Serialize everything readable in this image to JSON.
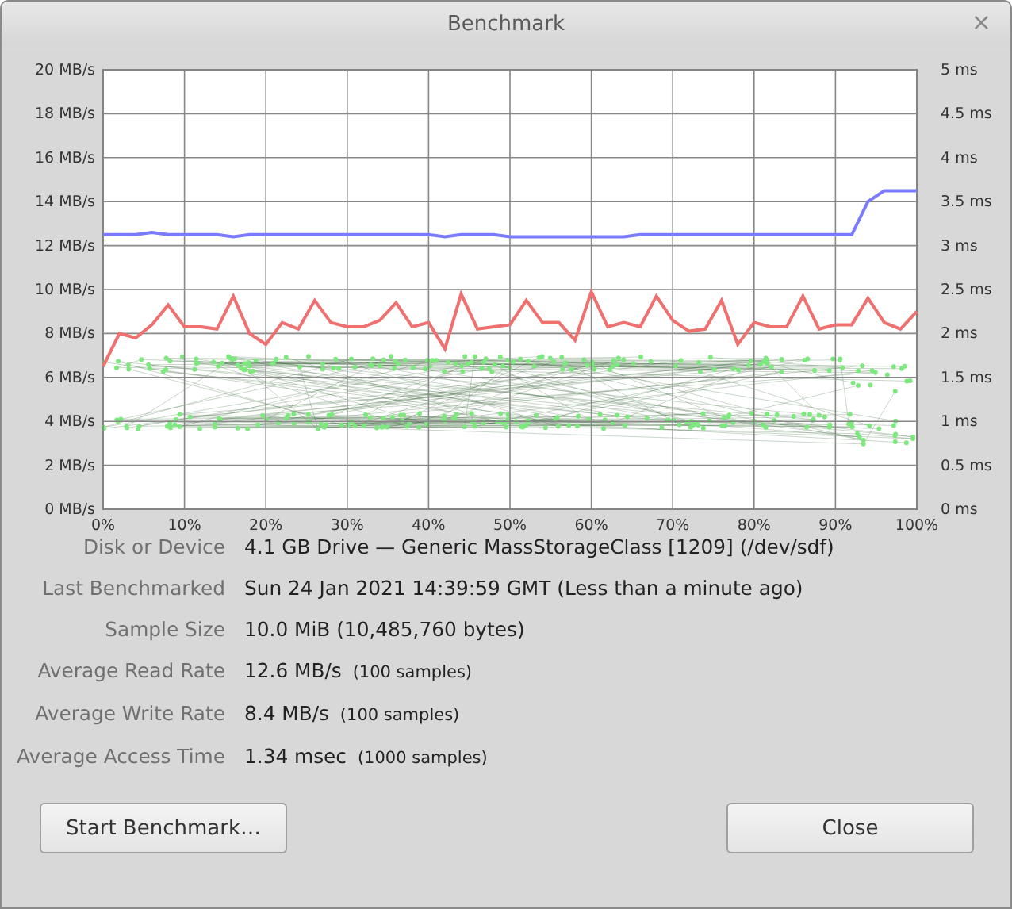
{
  "window": {
    "title": "Benchmark",
    "close_glyph": "×"
  },
  "chart": {
    "chart_data": {
      "type": "line",
      "x": [
        0,
        2,
        4,
        6,
        8,
        10,
        12,
        14,
        16,
        18,
        20,
        22,
        24,
        26,
        28,
        30,
        32,
        34,
        36,
        38,
        40,
        42,
        44,
        46,
        48,
        50,
        52,
        54,
        56,
        58,
        60,
        62,
        64,
        66,
        68,
        70,
        72,
        74,
        76,
        78,
        80,
        82,
        84,
        86,
        88,
        90,
        92,
        94,
        96,
        98,
        100
      ],
      "xlim": [
        0,
        100
      ],
      "ylim": [
        0,
        20
      ],
      "xticks": [
        {
          "value": 0,
          "label": "0%"
        },
        {
          "value": 10,
          "label": "10%"
        },
        {
          "value": 20,
          "label": "20%"
        },
        {
          "value": 30,
          "label": "30%"
        },
        {
          "value": 40,
          "label": "40%"
        },
        {
          "value": 50,
          "label": "50%"
        },
        {
          "value": 60,
          "label": "60%"
        },
        {
          "value": 70,
          "label": "70%"
        },
        {
          "value": 80,
          "label": "80%"
        },
        {
          "value": 90,
          "label": "90%"
        },
        {
          "value": 100,
          "label": "100%"
        }
      ],
      "yticks": [
        {
          "value": 0,
          "label": "0 MB/s"
        },
        {
          "value": 2,
          "label": "2 MB/s"
        },
        {
          "value": 4,
          "label": "4 MB/s"
        },
        {
          "value": 6,
          "label": "6 MB/s"
        },
        {
          "value": 8,
          "label": "8 MB/s"
        },
        {
          "value": 10,
          "label": "10 MB/s"
        },
        {
          "value": 12,
          "label": "12 MB/s"
        },
        {
          "value": 14,
          "label": "14 MB/s"
        },
        {
          "value": 16,
          "label": "16 MB/s"
        },
        {
          "value": 18,
          "label": "18 MB/s"
        },
        {
          "value": 20,
          "label": "20 MB/s"
        }
      ],
      "grid": true,
      "series": [
        {
          "color": "#7b7bff",
          "values": [
            12.5,
            12.5,
            12.5,
            12.6,
            12.5,
            12.5,
            12.5,
            12.5,
            12.4,
            12.5,
            12.5,
            12.5,
            12.5,
            12.5,
            12.5,
            12.5,
            12.5,
            12.5,
            12.5,
            12.5,
            12.5,
            12.4,
            12.5,
            12.5,
            12.5,
            12.4,
            12.4,
            12.4,
            12.4,
            12.4,
            12.4,
            12.4,
            12.4,
            12.5,
            12.5,
            12.5,
            12.5,
            12.5,
            12.5,
            12.5,
            12.5,
            12.5,
            12.5,
            12.5,
            12.5,
            12.5,
            12.5,
            14.0,
            14.5,
            14.5,
            14.5
          ]
        },
        {
          "color": "#f07070",
          "values": [
            6.5,
            8.0,
            7.8,
            8.4,
            9.3,
            8.3,
            8.3,
            8.2,
            9.7,
            8.0,
            7.5,
            8.5,
            8.2,
            9.5,
            8.5,
            8.3,
            8.3,
            8.6,
            9.4,
            8.3,
            8.5,
            7.3,
            9.8,
            8.2,
            8.3,
            8.4,
            9.5,
            8.5,
            8.5,
            7.7,
            9.9,
            8.3,
            8.5,
            8.3,
            9.7,
            8.6,
            8.1,
            8.2,
            9.5,
            7.5,
            8.5,
            8.3,
            8.3,
            9.7,
            8.2,
            8.4,
            8.4,
            9.6,
            8.5,
            8.2,
            9.0
          ]
        }
      ]
    },
    "right_axis_labels": [
      "5 ms",
      "4.5 ms",
      "4 ms",
      "3.5 ms",
      "3 ms",
      "2.5 ms",
      "2 ms",
      "1.5 ms",
      "1 ms",
      "0.5 ms",
      "0 ms"
    ]
  },
  "details": [
    {
      "label": "Disk or Device",
      "value": "4.1 GB Drive — Generic MassStorageClass [1209] (/dev/sdf)"
    },
    {
      "label": "Last Benchmarked",
      "value": "Sun 24 Jan 2021 14:39:59 GMT (Less than a minute ago)"
    },
    {
      "label": "Sample Size",
      "value": "10.0 MiB (10,485,760 bytes)"
    },
    {
      "label": "Average Read Rate",
      "value": "12.6 MB/s",
      "note": "(100 samples)"
    },
    {
      "label": "Average Write Rate",
      "value": "8.4 MB/s",
      "note": "(100 samples)"
    },
    {
      "label": "Average Access Time",
      "value": "1.34 msec",
      "note": "(1000 samples)"
    }
  ],
  "buttons": [
    {
      "label": "Start Benchmark…"
    },
    {
      "label": "Close"
    }
  ]
}
